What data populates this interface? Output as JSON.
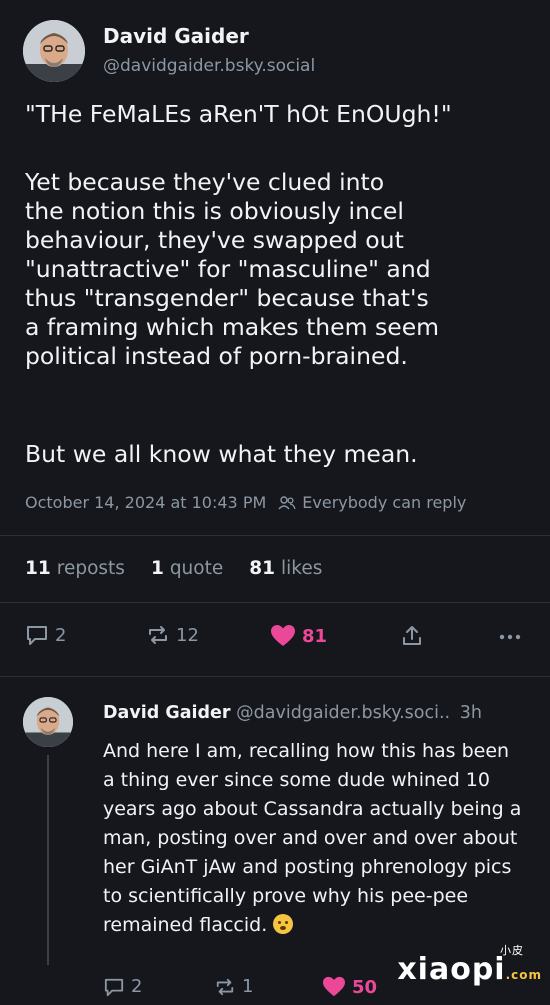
{
  "post": {
    "author_name": "David Gaider",
    "author_handle": "@davidgaider.bsky.social",
    "paragraph_1": "\"THe FeMaLEs aRen'T hOt EnOUgh!\"",
    "paragraph_2": "Yet because they've clued into\nthe notion this is obviously incel\nbehaviour, they've swapped out\n\"unattractive\" for \"masculine\" and\nthus \"transgender\" because that's\na framing which makes them seem\npolitical instead of porn-brained.",
    "paragraph_3": "But we all know what they mean.",
    "timestamp": "October 14, 2024 at 10:43 PM",
    "reply_permission": "Everybody can reply",
    "reposts_count": "11",
    "reposts_label": "reposts",
    "quotes_count": "1",
    "quotes_label": "quote",
    "likes_count": "81",
    "likes_label": "likes",
    "actions": {
      "reply_count": "2",
      "repost_count": "12",
      "like_count": "81"
    }
  },
  "reply": {
    "author_name": "David Gaider",
    "author_handle": "@davidgaider.bsky.soci..",
    "time": "3h",
    "text": "And here I am, recalling how this has been a thing ever since some dude whined 10 years ago about Cassandra actually being a man, posting over and over and over about her GiAnT jAw and posting phrenology pics to scientifically prove why his pee-pee remained flaccid.",
    "actions": {
      "reply_count": "2",
      "repost_count": "1",
      "like_count": "50"
    }
  },
  "watermark": {
    "main": "xiaopi",
    "small": "小皮",
    "domain": ".com"
  },
  "colors": {
    "background": "#15171c",
    "muted": "#8c97a3",
    "like": "#ec4899"
  }
}
